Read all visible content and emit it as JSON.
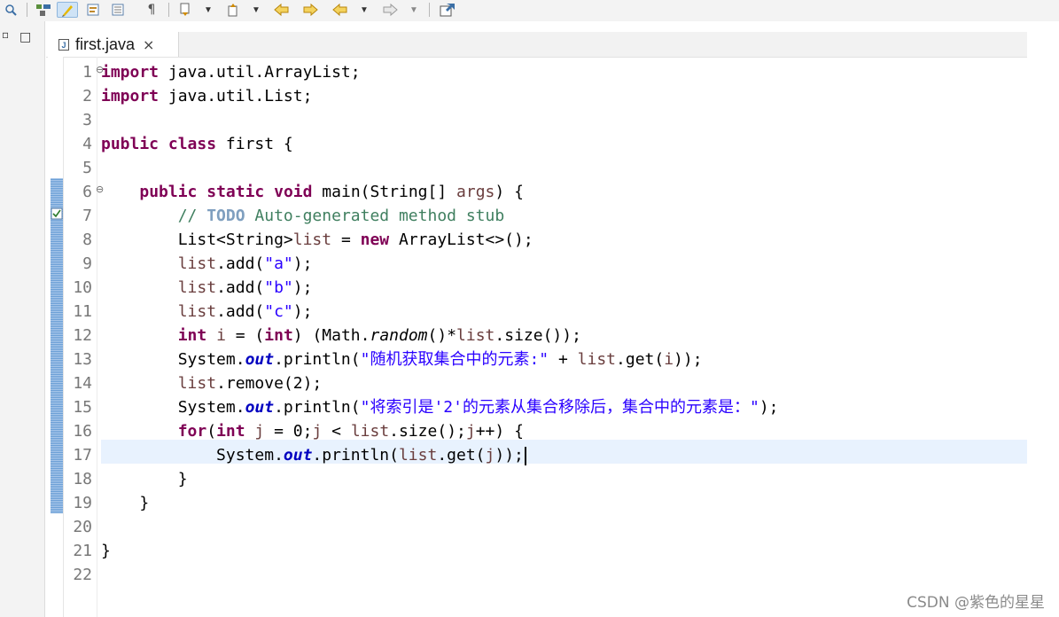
{
  "editor": {
    "tab": {
      "label": "first.java",
      "close": "×"
    },
    "current_line": 17,
    "lines": [
      {
        "num": "1",
        "fold": "⊖",
        "text": "import java.util.ArrayList;"
      },
      {
        "num": "2",
        "text": "import java.util.List;"
      },
      {
        "num": "3",
        "text": ""
      },
      {
        "num": "4",
        "text": "public class first {"
      },
      {
        "num": "5",
        "text": ""
      },
      {
        "num": "6",
        "fold": "⊖",
        "text": "    public static void main(String[] args) {"
      },
      {
        "num": "7",
        "text": "        // TODO Auto-generated method stub"
      },
      {
        "num": "8",
        "text": "        List<String>list = new ArrayList<>();"
      },
      {
        "num": "9",
        "text": "        list.add(\"a\");"
      },
      {
        "num": "10",
        "text": "        list.add(\"b\");"
      },
      {
        "num": "11",
        "text": "        list.add(\"c\");"
      },
      {
        "num": "12",
        "text": "        int i = (int) (Math.random()*list.size());"
      },
      {
        "num": "13",
        "text": "        System.out.println(\"随机获取集合中的元素:\" + list.get(i));"
      },
      {
        "num": "14",
        "text": "        list.remove(2);"
      },
      {
        "num": "15",
        "text": "        System.out.println(\"将索引是'2'的元素从集合移除后，集合中的元素是：\");"
      },
      {
        "num": "16",
        "text": "        for(int j = 0;j < list.size();j++) {"
      },
      {
        "num": "17",
        "text": "            System.out.println(list.get(j));"
      },
      {
        "num": "18",
        "text": "        }"
      },
      {
        "num": "19",
        "text": "    }"
      },
      {
        "num": "20",
        "text": ""
      },
      {
        "num": "21",
        "text": "}"
      },
      {
        "num": "22",
        "text": ""
      }
    ]
  },
  "watermark": "CSDN @紫色的星星",
  "toolbar": {
    "icons": [
      "open-type-icon",
      "toggle-breadcrumb-icon",
      "mark-occurrences-icon",
      "block-selection-icon",
      "word-wrap-icon",
      "show-whitespace-icon",
      "next-annotation-icon",
      "previous-annotation-icon",
      "last-edit-location-icon",
      "back-icon",
      "forward-icon",
      "pin-editor-icon"
    ]
  },
  "colors": {
    "keyword": "#7f0055",
    "string": "#2a00ff",
    "comment": "#3f7f5f",
    "local_variable": "#6a3e3e",
    "static_field": "#0000c0",
    "current_line_bg": "#e8f2fe",
    "line_number": "#787878"
  }
}
